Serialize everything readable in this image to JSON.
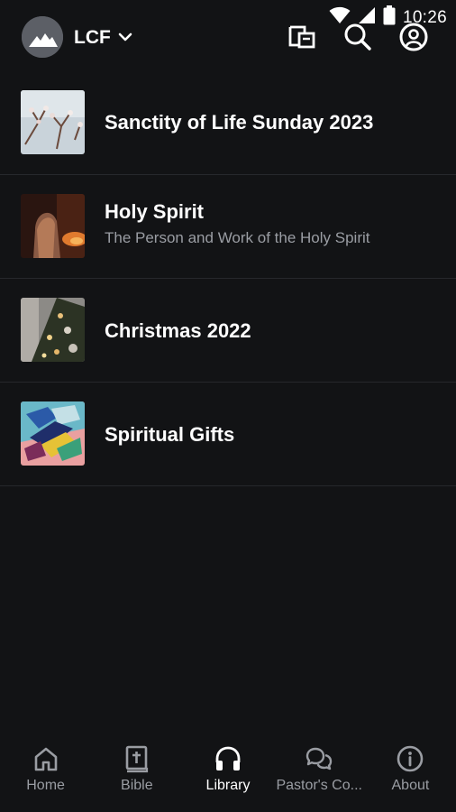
{
  "status_bar": {
    "time": "10:26"
  },
  "header": {
    "church_name": "LCF",
    "icons": [
      "notes-icon",
      "search-icon",
      "profile-icon"
    ]
  },
  "series": [
    {
      "title": "Sanctity of Life Sunday 2023",
      "subtitle": ""
    },
    {
      "title": "Holy Spirit",
      "subtitle": "The Person and Work of the Holy Spirit"
    },
    {
      "title": "Christmas 2022",
      "subtitle": ""
    },
    {
      "title": "Spiritual Gifts",
      "subtitle": ""
    }
  ],
  "bottom_nav": {
    "active": "Library",
    "items": [
      {
        "label": "Home",
        "icon": "home-icon"
      },
      {
        "label": "Bible",
        "icon": "bible-icon"
      },
      {
        "label": "Library",
        "icon": "headphones-icon"
      },
      {
        "label": "Pastor's Co...",
        "icon": "chat-icon"
      },
      {
        "label": "About",
        "icon": "info-icon"
      }
    ]
  },
  "colors": {
    "background": "#121315",
    "divider": "#26282c",
    "text_primary": "#ffffff",
    "text_secondary": "#9a9da3"
  }
}
